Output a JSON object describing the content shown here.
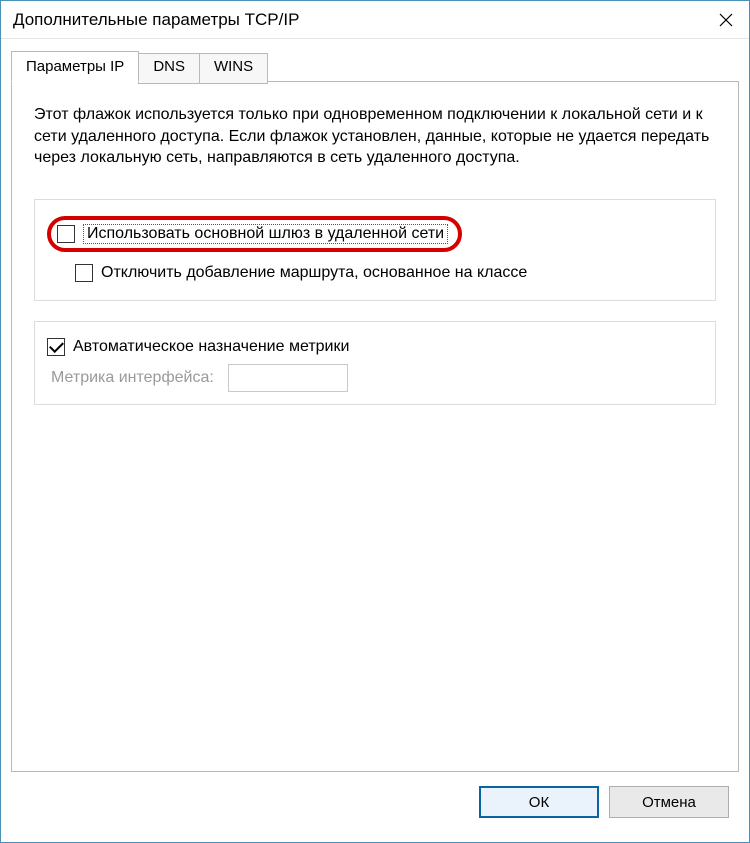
{
  "window": {
    "title": "Дополнительные параметры TCP/IP"
  },
  "tabs": {
    "ip": "Параметры IP",
    "dns": "DNS",
    "wins": "WINS"
  },
  "panel": {
    "description": "Этот флажок используется только при одновременном подключении к локальной сети и к сети удаленного доступа. Если флажок установлен, данные, которые не удается передать через локальную сеть, направляются в сеть удаленного доступа.",
    "gateway_label": "Использовать основной шлюз в удаленной сети",
    "class_route_label": "Отключить добавление маршрута, основанное на классе",
    "auto_metric_label": "Автоматическое назначение метрики",
    "metric_label": "Метрика интерфейса:"
  },
  "buttons": {
    "ok": "ОК",
    "cancel": "Отмена"
  }
}
